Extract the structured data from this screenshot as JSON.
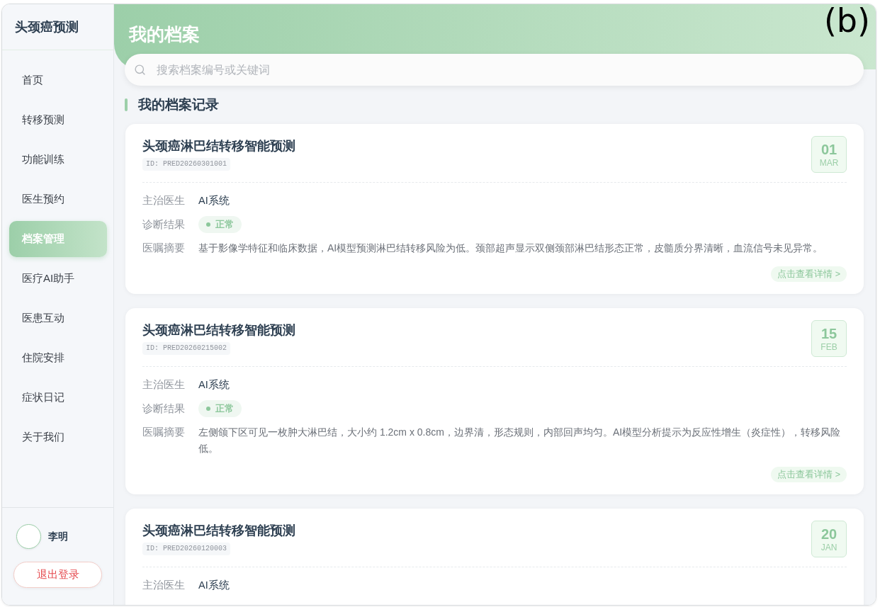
{
  "panel_label": "(b)",
  "sidebar": {
    "title": "头颈癌预测",
    "items": [
      {
        "label": "首页",
        "selected": false
      },
      {
        "label": "转移预测",
        "selected": false
      },
      {
        "label": "功能训练",
        "selected": false
      },
      {
        "label": "医生预约",
        "selected": false
      },
      {
        "label": "档案管理",
        "selected": true
      },
      {
        "label": "医疗AI助手",
        "selected": false
      },
      {
        "label": "医患互动",
        "selected": false
      },
      {
        "label": "住院安排",
        "selected": false
      },
      {
        "label": "症状日记",
        "selected": false
      },
      {
        "label": "关于我们",
        "selected": false
      }
    ],
    "user": {
      "name": "李明"
    },
    "logout": "退出登录"
  },
  "header": {
    "title": "我的档案"
  },
  "search": {
    "placeholder": "搜索档案编号或关键词"
  },
  "section_title": "我的档案记录",
  "records": [
    {
      "title": "头颈癌淋巴结转移智能预测",
      "id": "ID: PRED20260301001",
      "day": "01",
      "month": "MAR",
      "fields": [
        {
          "kind": "text",
          "label": "主治医生",
          "value": "AI系统"
        },
        {
          "kind": "status",
          "label": "诊断结果",
          "value": "正常",
          "color": "#8cc79b"
        },
        {
          "kind": "note",
          "label": "医嘱摘要",
          "value": "基于影像学特征和临床数据，AI模型预测淋巴结转移风险为低。颈部超声显示双侧颈部淋巴结形态正常，皮髓质分界清晰，血流信号未见异常。"
        }
      ],
      "details": "点击查看详情 >"
    },
    {
      "title": "头颈癌淋巴结转移智能预测",
      "id": "ID: PRED20260215002",
      "day": "15",
      "month": "FEB",
      "fields": [
        {
          "kind": "text",
          "label": "主治医生",
          "value": "AI系统"
        },
        {
          "kind": "status",
          "label": "诊断结果",
          "value": "正常",
          "color": "#8cc79b"
        },
        {
          "kind": "note",
          "label": "医嘱摘要",
          "value": "左侧颌下区可见一枚肿大淋巴结，大小约 1.2cm x 0.8cm，边界清，形态规则，内部回声均匀。AI模型分析提示为反应性增生（炎症性），转移风险低。"
        }
      ],
      "details": "点击查看详情 >"
    },
    {
      "title": "头颈癌淋巴结转移智能预测",
      "id": "ID: PRED20260120003",
      "day": "20",
      "month": "JAN",
      "fields": [
        {
          "kind": "text",
          "label": "主治医生",
          "value": "AI系统"
        }
      ]
    }
  ]
}
